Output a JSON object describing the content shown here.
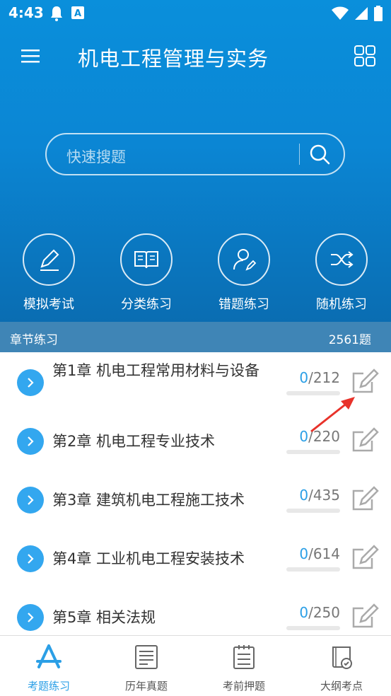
{
  "status": {
    "time": "4:43"
  },
  "header": {
    "title": "机电工程管理与实务"
  },
  "search": {
    "placeholder": "快速搜题"
  },
  "quick_actions": [
    {
      "label": "模拟考试",
      "icon": "pen-icon"
    },
    {
      "label": "分类练习",
      "icon": "book-icon"
    },
    {
      "label": "错题练习",
      "icon": "user-edit-icon"
    },
    {
      "label": "随机练习",
      "icon": "shuffle-icon"
    }
  ],
  "section": {
    "title": "章节练习",
    "count": "2561题"
  },
  "chapters": [
    {
      "name": "第1章 机电工程常用材料与设备",
      "done": "0",
      "total": "/212"
    },
    {
      "name": "第2章 机电工程专业技术",
      "done": "0",
      "total": "/220"
    },
    {
      "name": "第3章 建筑机电工程施工技术",
      "done": "0",
      "total": "/435"
    },
    {
      "name": "第4章 工业机电工程安装技术",
      "done": "0",
      "total": "/614"
    },
    {
      "name": "第5章 相关法规",
      "done": "0",
      "total": "/250"
    }
  ],
  "tabs": [
    {
      "label": "考题练习",
      "active": true
    },
    {
      "label": "历年真题",
      "active": false
    },
    {
      "label": "考前押题",
      "active": false
    },
    {
      "label": "大纲考点",
      "active": false
    }
  ],
  "colors": {
    "accent": "#2b9fe6",
    "hero": "#0a8fdb",
    "section": "#3f85b6"
  }
}
